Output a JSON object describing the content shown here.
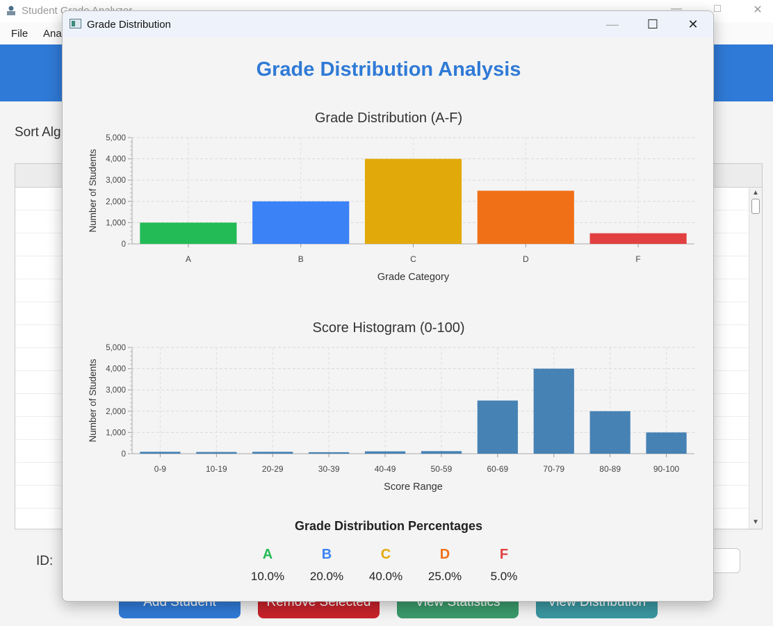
{
  "main_window": {
    "title": "Student Grade Analyzer",
    "menu": [
      "File",
      "Ana"
    ],
    "sort_label": "Sort Alg",
    "id_label": "ID:",
    "buttons": [
      {
        "label": "Add Student",
        "color": "#2f7ad6"
      },
      {
        "label": "Remove Selected",
        "color": "#c8232b"
      },
      {
        "label": "View Statistics",
        "color": "#3a9a6a"
      },
      {
        "label": "View Distribution",
        "color": "#3a96a0"
      }
    ]
  },
  "dialog": {
    "title": "Grade Distribution",
    "heading": "Grade Distribution Analysis",
    "percentages_title": "Grade Distribution Percentages",
    "percentages": [
      {
        "grade": "A",
        "value": "10.0%",
        "color": "#22bb55"
      },
      {
        "grade": "B",
        "value": "20.0%",
        "color": "#3b82f6"
      },
      {
        "grade": "C",
        "value": "40.0%",
        "color": "#e2a90a"
      },
      {
        "grade": "D",
        "value": "25.0%",
        "color": "#f07018"
      },
      {
        "grade": "F",
        "value": "5.0%",
        "color": "#e24040"
      }
    ]
  },
  "chart_data": [
    {
      "type": "bar",
      "title": "Grade Distribution (A-F)",
      "xlabel": "Grade Category",
      "ylabel": "Number of Students",
      "categories": [
        "A",
        "B",
        "C",
        "D",
        "F"
      ],
      "values": [
        1000,
        2000,
        4000,
        2500,
        500
      ],
      "colors": [
        "#22bb55",
        "#3b82f6",
        "#e2a90a",
        "#f07018",
        "#e24040"
      ],
      "ylim": [
        0,
        5000
      ],
      "yticks": [
        "0",
        "1,000",
        "2,000",
        "3,000",
        "4,000",
        "5,000"
      ],
      "grid": true
    },
    {
      "type": "bar",
      "title": "Score Histogram (0-100)",
      "xlabel": "Score Range",
      "ylabel": "Number of Students",
      "categories": [
        "0-9",
        "10-19",
        "20-29",
        "30-39",
        "40-49",
        "50-59",
        "60-69",
        "70-79",
        "80-89",
        "90-100"
      ],
      "values": [
        90,
        80,
        90,
        70,
        110,
        120,
        2500,
        4000,
        2000,
        1000
      ],
      "colors": [
        "#4682b4"
      ],
      "ylim": [
        0,
        5000
      ],
      "yticks": [
        "0",
        "1,000",
        "2,000",
        "3,000",
        "4,000",
        "5,000"
      ],
      "grid": true
    }
  ]
}
